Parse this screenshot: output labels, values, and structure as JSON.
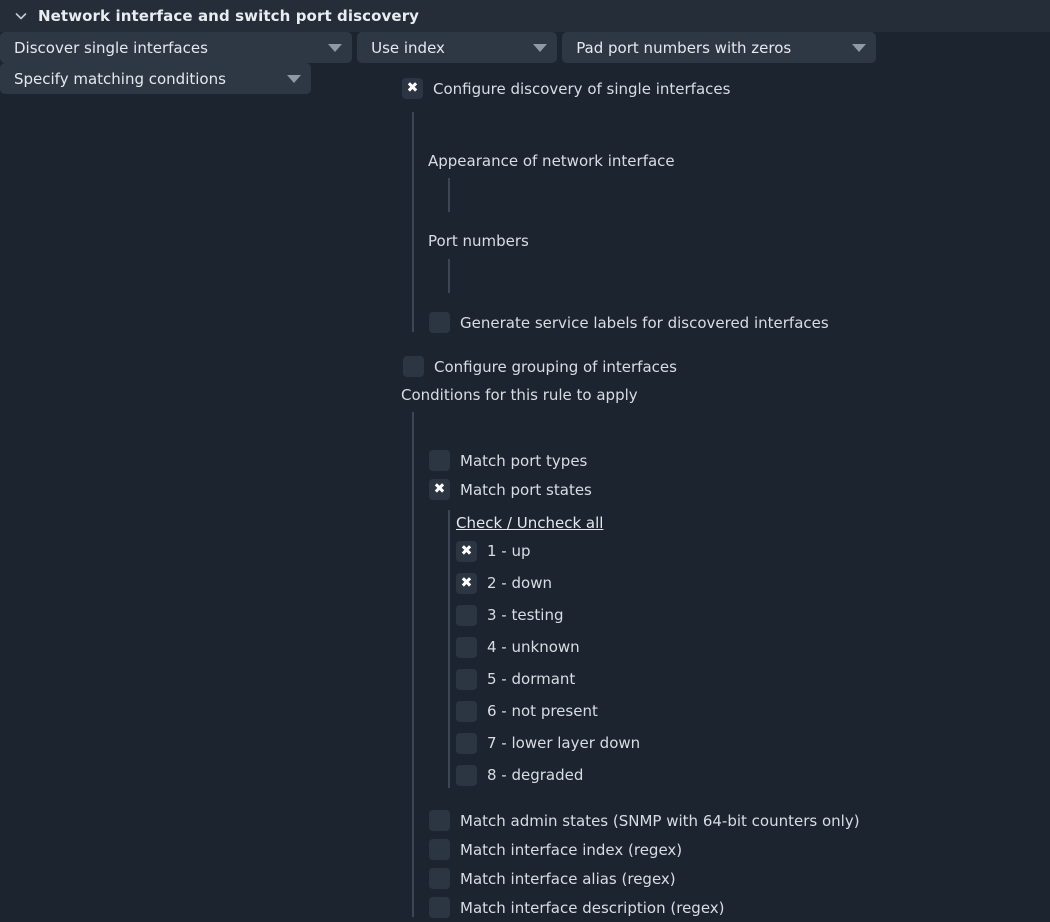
{
  "header": {
    "title": "Network interface and switch port discovery",
    "chevron_icon": "chevron-down-icon",
    "expanded": true
  },
  "colors": {
    "header_bg": "#252d38",
    "body_bg": "#1c2430",
    "checkbox_bg": "#2c3542",
    "dropdown_bg": "#2e3744",
    "guide_line": "#3d4654",
    "text": "#d8dde3",
    "arrow": "#8e99a6"
  },
  "form": {
    "configure_single_interfaces": {
      "label": "Configure discovery of single interfaces",
      "checked": true,
      "mark": "✖"
    },
    "discover_single_interfaces_select": {
      "value": "Discover single interfaces",
      "arrow_icon": "chevron-down-icon"
    },
    "appearance_label": "Appearance of network interface",
    "appearance_select": {
      "value": "Use index",
      "arrow_icon": "chevron-down-icon"
    },
    "port_numbers_label": "Port numbers",
    "port_numbers_select": {
      "value": "Pad port numbers with zeros",
      "arrow_icon": "chevron-down-icon"
    },
    "generate_service_labels": {
      "label": "Generate service labels for discovered interfaces",
      "checked": false,
      "mark": ""
    },
    "configure_grouping": {
      "label": "Configure grouping of interfaces",
      "checked": false,
      "mark": ""
    },
    "conditions_label": "Conditions for this rule to apply",
    "conditions_select": {
      "value": "Specify matching conditions",
      "arrow_icon": "chevron-down-icon"
    },
    "match_port_types": {
      "label": "Match port types",
      "checked": false,
      "mark": ""
    },
    "match_port_states": {
      "label": "Match port states",
      "checked": true,
      "mark": "✖"
    },
    "check_uncheck_all": "Check / Uncheck all",
    "port_states": [
      {
        "label": "1 - up",
        "checked": true,
        "mark": "✖"
      },
      {
        "label": "2 - down",
        "checked": true,
        "mark": "✖"
      },
      {
        "label": "3 - testing",
        "checked": false,
        "mark": ""
      },
      {
        "label": "4 - unknown",
        "checked": false,
        "mark": ""
      },
      {
        "label": "5 - dormant",
        "checked": false,
        "mark": ""
      },
      {
        "label": "6 - not present",
        "checked": false,
        "mark": ""
      },
      {
        "label": "7 - lower layer down",
        "checked": false,
        "mark": ""
      },
      {
        "label": "8 - degraded",
        "checked": false,
        "mark": ""
      }
    ],
    "trailing_matches": [
      {
        "label": "Match admin states (SNMP with 64-bit counters only)",
        "checked": false,
        "mark": ""
      },
      {
        "label": "Match interface index (regex)",
        "checked": false,
        "mark": ""
      },
      {
        "label": "Match interface alias (regex)",
        "checked": false,
        "mark": ""
      },
      {
        "label": "Match interface description (regex)",
        "checked": false,
        "mark": ""
      }
    ]
  }
}
